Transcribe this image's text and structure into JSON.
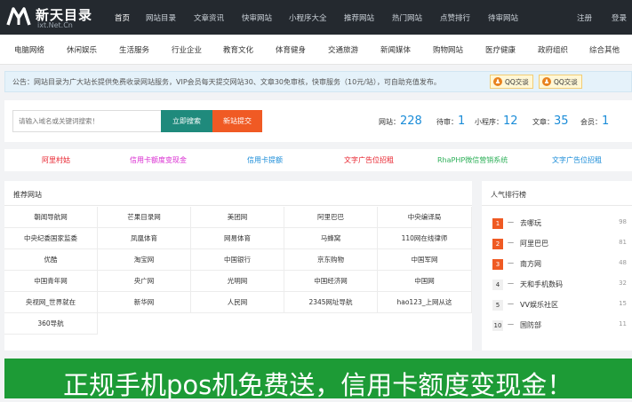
{
  "brand": {
    "title": "新天目录",
    "subtitle": "ixt.Net.Cn"
  },
  "topnav": {
    "items": [
      "首页",
      "网站目录",
      "文章资讯",
      "快审网站",
      "小程序大全",
      "推荐网站",
      "热门网站",
      "点赞排行",
      "待审网站"
    ],
    "login": "注册",
    "register": "登录"
  },
  "categories": [
    "电脑网络",
    "休闲娱乐",
    "生活服务",
    "行业企业",
    "教育文化",
    "体育健身",
    "交通旅游",
    "新闻媒体",
    "购物网站",
    "医疗健康",
    "政府组织",
    "综合其他"
  ],
  "notice": {
    "text": "公告：网站目录为广大站长提供免费收录网站服务，VIP会员每天提交网站30、文章30免审核，快审服务（10元/站），可自助充值发布。",
    "qq1": "QQ交谈",
    "qq2": "QQ交谈"
  },
  "search": {
    "placeholder": "请输入域名或关键词搜索！",
    "search_label": "立即搜索",
    "submit_label": "新站提交"
  },
  "stats": {
    "sites_label": "网站：",
    "sites": "228",
    "pending_label": "待审：",
    "pending": "1",
    "apps_label": "小程序：",
    "apps": "12",
    "articles_label": "文章：",
    "articles": "35",
    "members_label": "会员：",
    "members": "1"
  },
  "ads": [
    {
      "text": "阿里村姑",
      "color": "#e8242f"
    },
    {
      "text": "信用卡额度变现金",
      "color": "#d92ad1"
    },
    {
      "text": "信用卡提额",
      "color": "#1a8cd8"
    },
    {
      "text": "文字广告位招租",
      "color": "#e8242f"
    },
    {
      "text": "RhaPHP微信营销系统",
      "color": "#2fb05a"
    },
    {
      "text": "文字广告位招租",
      "color": "#1a8cd8"
    }
  ],
  "recommended": {
    "title": "推荐网站",
    "rows": [
      [
        "朝闻导航网",
        "芒果目录网",
        "美团网",
        "阿里巴巴",
        "中央编译局"
      ],
      [
        "中央纪委国家监委",
        "凤凰体育",
        "网易体育",
        "马蜂窝",
        "110网在线律师"
      ],
      [
        "优酷",
        "淘宝网",
        "中国银行",
        "京东购物",
        "中国军网"
      ],
      [
        "中国青年网",
        "央广网",
        "光明网",
        "中国经济网",
        "中国网"
      ],
      [
        "央视网_世界就在",
        "新华网",
        "人民网",
        "2345网址导航",
        "hao123_上网从这"
      ],
      [
        "360导航"
      ]
    ]
  },
  "ranking": {
    "title": "人气排行榜",
    "items": [
      {
        "rank": "1",
        "dash": "一",
        "name": "去哪玩",
        "count": "98"
      },
      {
        "rank": "2",
        "dash": "一",
        "name": "阿里巴巴",
        "count": "81"
      },
      {
        "rank": "3",
        "dash": "一",
        "name": "南方网",
        "count": "48"
      },
      {
        "rank": "4",
        "dash": "一",
        "name": "天和手机数码",
        "count": "32"
      },
      {
        "rank": "5",
        "dash": "一",
        "name": "VV娱乐社区",
        "count": "15"
      },
      {
        "rank": "10",
        "dash": "一",
        "name": "国防部",
        "count": "11"
      }
    ]
  },
  "banner": {
    "text": "正规手机pos机免费送，信用卡额度变现金！"
  },
  "colors": {
    "topbar": "#24292f",
    "accent": "#1a8cd8",
    "search_btn": "#1f8a7c",
    "submit_btn": "#f05a24",
    "banner": "#1d9b36"
  }
}
